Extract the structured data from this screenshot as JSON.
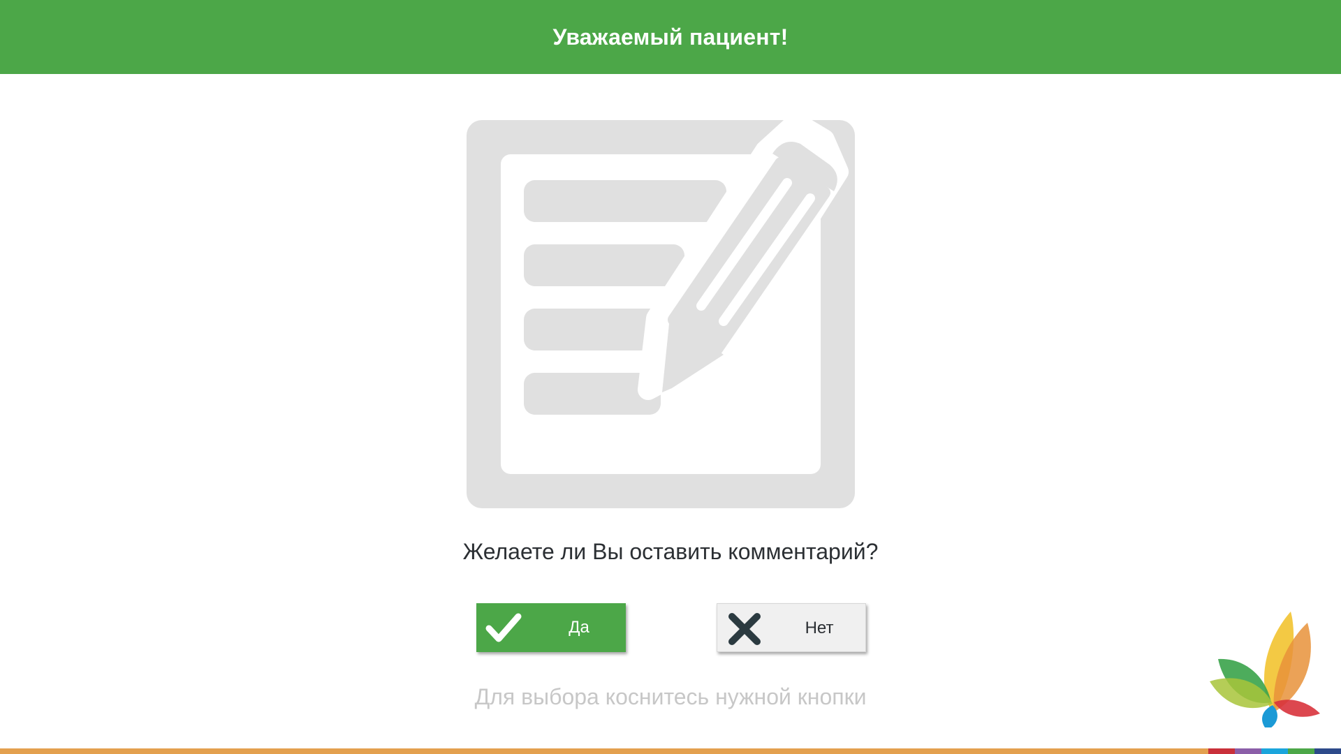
{
  "header": {
    "title": "Уважаемый пациент!"
  },
  "main": {
    "question": "Желаете ли Вы оставить комментарий?",
    "hint": "Для выбора коснитесь нужной кнопки"
  },
  "buttons": {
    "yes": {
      "label": "Да",
      "icon": "checkmark-icon"
    },
    "no": {
      "label": "Нет",
      "icon": "cross-icon"
    }
  },
  "colors": {
    "brand_green": "#4ca748",
    "illustration_gray": "#e0e0e0",
    "hint_gray": "#c7c7c7",
    "footer_orange": "#e3a04f",
    "footer_segments": [
      "#c9303a",
      "#8b5ea8",
      "#1ba5dc",
      "#4ca748",
      "#2d4a8a"
    ]
  },
  "logo": {
    "icon": "butterfly-petals-logo"
  }
}
